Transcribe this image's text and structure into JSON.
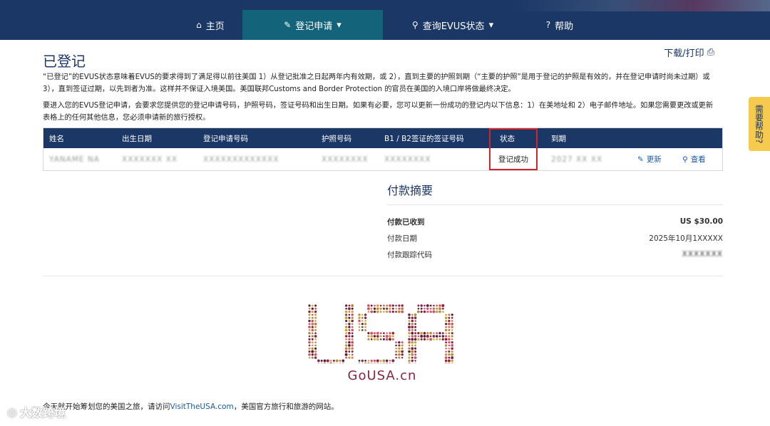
{
  "nav": {
    "items": [
      {
        "label": "主页",
        "icon": "home-icon",
        "glyph": "⌂"
      },
      {
        "label": "登记申请",
        "icon": "pencil-icon",
        "glyph": "✎",
        "caret": "▾"
      },
      {
        "label": "查询EVUS状态",
        "icon": "search-icon",
        "glyph": "⚲",
        "caret": "▾"
      },
      {
        "label": "帮助",
        "icon": "question-icon",
        "glyph": "?"
      }
    ]
  },
  "page": {
    "title": "已登记",
    "print_label": "下载/打印",
    "print_icon": "⎙",
    "para1": "“已登记”的EVUS状态意味着EVUS的要求得到了满足得以前往美国 1）从登记批准之日起两年内有效期，或 2），直到主要的护照到期（“主要的护照”是用于登记的护照是有效的，并在登记申请时尚未过期）或 3），直到签证过期，以先到者为准。这样并不保证入境美国。美国联邦Customs and Border Protection 的官员在美国的入境口岸将做最终决定。",
    "para2": "要进入您的EVUS登记申请，会要求您提供您的登记申请号码，护照号码，签证号码和出生日期。如果有必要，您可以更新一份成功的登记内以下信息：1）在美地址和 2）电子邮件地址。如果您需要更改或更新表格上的任何其他信息，您必须申请新的旅行授权。"
  },
  "table": {
    "headers": [
      "姓名",
      "出生日期",
      "登记申请号码",
      "护照号码",
      "B1 / B2签证的签证号码",
      "状态",
      "到期"
    ],
    "row": {
      "name": "YANAME NA",
      "dob": "XXXXXXX XX",
      "app_no": "XXXXXXXXXXXXX",
      "passport": "XXXXXXXX",
      "visa": "XXXXXXXX",
      "status": "登记成功",
      "expiry": "2027 XX XX",
      "update_label": "更新",
      "view_label": "查看"
    }
  },
  "payment": {
    "title": "付款摘要",
    "received_label": "付款已收到",
    "received_value": "US $30.00",
    "date_label": "付款日期",
    "date_value": "2025年10月1XXXXX",
    "tracking_label": "付款跟踪代码",
    "tracking_value": "XXXXXXX"
  },
  "logo": {
    "text": "GoUSA.cn",
    "colors": [
      "#8a2440",
      "#c9a13b",
      "#5a1e3a",
      "#d94f6a",
      "#b5883a"
    ]
  },
  "footer": {
    "prefix": "今天就开始筹划您的美国之旅，请访问",
    "link": "VisitTheUSA.com",
    "suffix": "，美国官方旅行和旅游的网站。"
  },
  "help_tab": "需要帮助?",
  "watermark": "大数跨境"
}
